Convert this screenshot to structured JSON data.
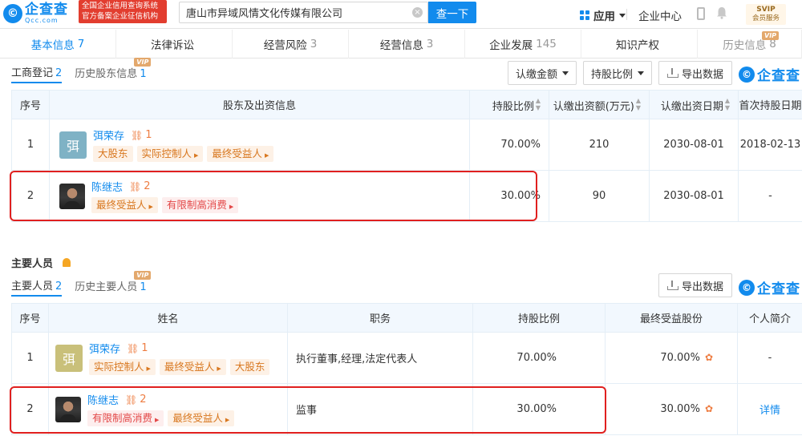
{
  "header": {
    "logo_cn": "企查查",
    "logo_en": "Qcc.com",
    "logo_mark": "©",
    "badge_line1": "全国企业信用查询系统",
    "badge_line2": "官方备案企业征信机构",
    "search_value": "唐山市异域风情文化传媒有限公司",
    "search_button": "查一下",
    "app_label": "应用",
    "center_label": "企业中心",
    "svip_top": "SVIP",
    "svip_bottom": "会员服务"
  },
  "tabs": [
    {
      "label": "基本信息",
      "count": "7",
      "active": true
    },
    {
      "label": "法律诉讼",
      "count": ""
    },
    {
      "label": "经营风险",
      "count": "3"
    },
    {
      "label": "经营信息",
      "count": "3"
    },
    {
      "label": "企业发展",
      "count": "145"
    },
    {
      "label": "知识产权",
      "count": ""
    },
    {
      "label": "历史信息",
      "count": "8",
      "vip": "VIP"
    }
  ],
  "shareholders": {
    "subtabs": [
      {
        "label": "工商登记",
        "count": "2"
      },
      {
        "label": "历史股东信息",
        "count": "1",
        "vip": "VIP"
      }
    ],
    "filter_amount": "认缴金额",
    "filter_ratio": "持股比例",
    "export_label": "导出数据",
    "brand": "企查查",
    "columns": [
      "序号",
      "股东及出资信息",
      "持股比例",
      "认缴出资额(万元)",
      "认缴出资日期",
      "首次持股日期"
    ],
    "rows": [
      {
        "index": "1",
        "avatar_char": "弭",
        "name": "弭荣存",
        "link_count": "1",
        "tags": [
          "大股东",
          "实际控制人",
          "最终受益人"
        ],
        "ratio": "70.00%",
        "amount": "210",
        "date": "2030-08-01",
        "first_date": "2018-02-13"
      },
      {
        "index": "2",
        "avatar_char": "",
        "name": "陈继志",
        "link_count": "2",
        "tags": [
          "最终受益人",
          "有限制高消费"
        ],
        "ratio": "30.00%",
        "amount": "90",
        "date": "2030-08-01",
        "first_date": "-"
      }
    ]
  },
  "key_personnel": {
    "title": "主要人员",
    "subtabs": [
      {
        "label": "主要人员",
        "count": "2"
      },
      {
        "label": "历史主要人员",
        "count": "1",
        "vip": "VIP"
      }
    ],
    "export_label": "导出数据",
    "brand": "企查查",
    "columns": [
      "序号",
      "姓名",
      "职务",
      "持股比例",
      "最终受益股份",
      "个人简介"
    ],
    "rows": [
      {
        "index": "1",
        "avatar_char": "弭",
        "name": "弭荣存",
        "link_count": "1",
        "tags": [
          "实际控制人",
          "最终受益人",
          "大股东"
        ],
        "position": "执行董事,经理,法定代表人",
        "ratio": "70.00%",
        "benefit": "70.00%",
        "profile": "-"
      },
      {
        "index": "2",
        "avatar_char": "",
        "name": "陈继志",
        "link_count": "2",
        "tags": [
          "有限制高消费",
          "最终受益人"
        ],
        "position": "监事",
        "ratio": "30.00%",
        "benefit": "30.00%",
        "profile": "详情"
      }
    ]
  },
  "colors": {
    "accent": "#128bed",
    "tag_orange": "#d8771f",
    "tag_red": "#e34848",
    "highlight": "#e0201f"
  }
}
